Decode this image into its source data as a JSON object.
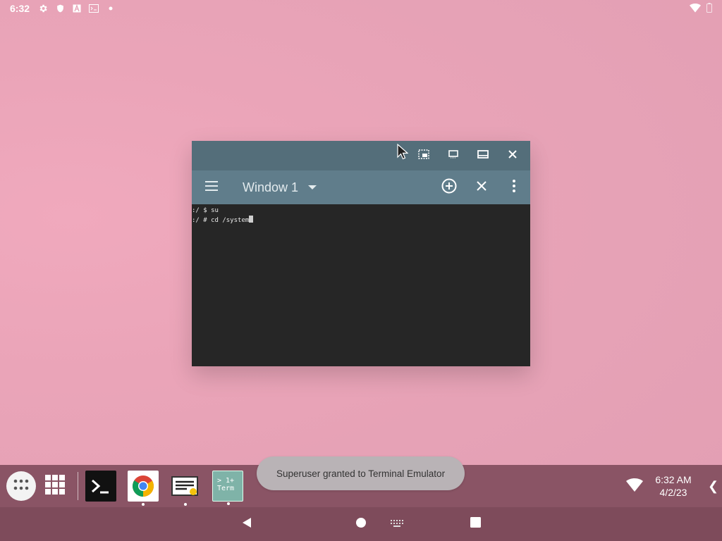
{
  "status_bar": {
    "time": "6:32",
    "icons": [
      "gear-icon",
      "shield-icon",
      "font-a-icon",
      "terminal-small-icon",
      "dot-icon"
    ],
    "right_icons": [
      "wifi-icon",
      "battery-icon"
    ]
  },
  "window": {
    "title": "Window 1",
    "caption_buttons": [
      "picture-in-picture-icon",
      "restore-icon",
      "maximize-icon",
      "close-icon"
    ],
    "toolbar_actions": [
      "add-circle-icon",
      "close-icon",
      "more-vert-icon"
    ],
    "terminal_lines": [
      ":/ $ su",
      ":/ # cd /system"
    ]
  },
  "taskbar": {
    "apps": [
      "Terminal Emulator",
      "Chrome",
      "Notes",
      "1+ Term"
    ],
    "tray_time": "6:32 AM",
    "tray_date": "4/2/23",
    "term_icon_label_1": "> 1+",
    "term_icon_label_2": "Term"
  },
  "toast": {
    "message": "Superuser granted to Terminal Emulator"
  },
  "colors": {
    "caption_bar": "#546e7a",
    "toolbar": "#607d8b",
    "terminal_bg": "#262626",
    "taskbar": "#8a5465",
    "navbar": "#7e4b5b"
  }
}
